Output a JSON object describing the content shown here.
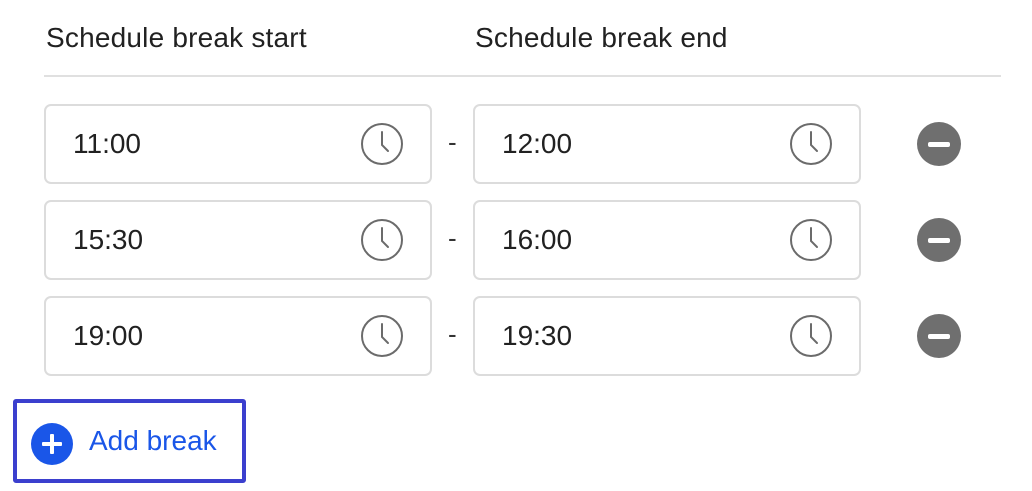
{
  "headers": {
    "start": "Schedule break start",
    "end": "Schedule break end"
  },
  "separator": "-",
  "breaks": [
    {
      "start": "11:00",
      "end": "12:00"
    },
    {
      "start": "15:30",
      "end": "16:00"
    },
    {
      "start": "19:00",
      "end": "19:30"
    }
  ],
  "add_break_label": "Add break",
  "icons": {
    "time_field": "clock-icon",
    "remove": "minus-circle-icon",
    "add": "plus-circle-icon"
  },
  "colors": {
    "accent": "#1a56e8",
    "focus_ring": "#3b3fce",
    "remove_button": "#6f6f6f",
    "field_border": "#dcdcdc"
  }
}
